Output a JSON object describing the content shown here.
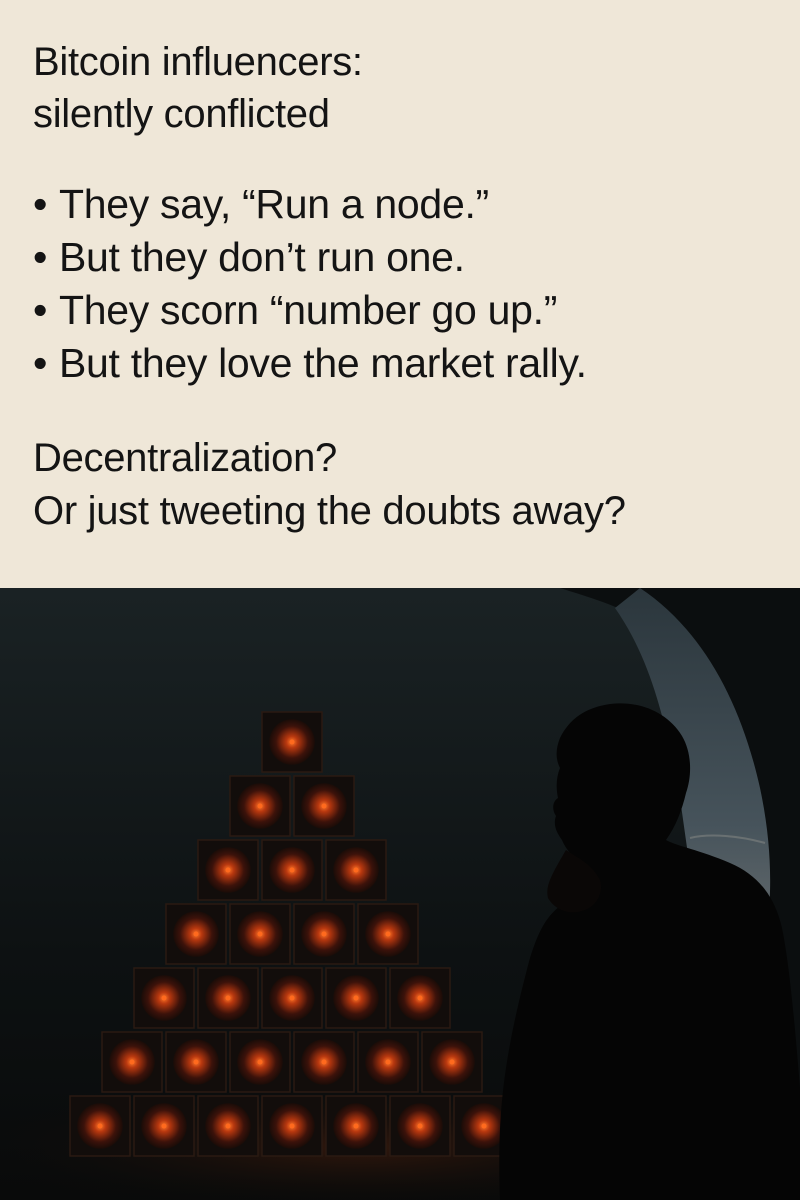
{
  "post": {
    "title_lines": [
      "Bitcoin influencers:",
      "silently conflicted"
    ],
    "bullets": [
      "They say, “Run a node.”",
      "But they don’t run one.",
      "They scorn “number go up.”",
      "But they love the market rally."
    ],
    "bullet_glyph": "•",
    "closing_lines": [
      "Decentralization?",
      "Or just tweeting the doubts away?"
    ]
  },
  "illustration": {
    "subject": "silhouette-of-man-thinking",
    "object": "pyramid-of-glowing-mining-rigs",
    "rig_rows": [
      1,
      2,
      3,
      4,
      5,
      6,
      7
    ],
    "colors": {
      "background_text_panel": "#efe7d8",
      "text": "#141414",
      "cave_dark": "#0d1112",
      "glow": "#ff6a1e",
      "sky": "#3d4a52"
    }
  }
}
